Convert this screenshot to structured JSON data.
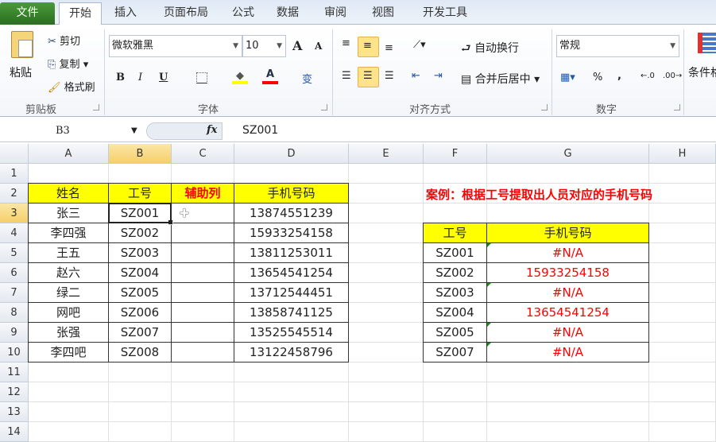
{
  "tabs": [
    "文件",
    "开始",
    "插入",
    "页面布局",
    "公式",
    "数据",
    "审阅",
    "视图",
    "开发工具"
  ],
  "ribbon": {
    "clipboard": {
      "paste": "粘贴",
      "cut": "剪切",
      "copy": "复制",
      "format_painter": "格式刷",
      "label": "剪贴板"
    },
    "font": {
      "name": "微软雅黑",
      "size": "10",
      "bold": "B",
      "italic": "I",
      "underline": "U",
      "label": "字体",
      "grow": "A",
      "shrink": "A",
      "phonetic": "变"
    },
    "align": {
      "wrap": "自动换行",
      "merge": "合并后居中",
      "label": "对齐方式"
    },
    "number": {
      "format": "常规",
      "percent": "%",
      "comma": ",",
      "label": "数字"
    },
    "styles": {
      "conditional": "条件格"
    }
  },
  "formula_bar": {
    "name_box": "B3",
    "fx": "fx",
    "value": "SZ001"
  },
  "columns": [
    "A",
    "B",
    "C",
    "D",
    "E",
    "F",
    "G",
    "H"
  ],
  "rows": [
    "1",
    "2",
    "3",
    "4",
    "5",
    "6",
    "7",
    "8",
    "9",
    "10",
    "11",
    "12",
    "13",
    "14"
  ],
  "table1": {
    "headers": [
      "姓名",
      "工号",
      "辅助列",
      "手机号码"
    ],
    "rows": [
      [
        "张三",
        "SZ001",
        "",
        "13874551239"
      ],
      [
        "李四强",
        "SZ002",
        "",
        "15933254158"
      ],
      [
        "王五",
        "SZ003",
        "",
        "13811253011"
      ],
      [
        "赵六",
        "SZ004",
        "",
        "13654541254"
      ],
      [
        "绿二",
        "SZ005",
        "",
        "13712544451"
      ],
      [
        "网吧",
        "SZ006",
        "",
        "13858741125"
      ],
      [
        "张强",
        "SZ007",
        "",
        "13525545514"
      ],
      [
        "李四吧",
        "SZ008",
        "",
        "13122458796"
      ]
    ]
  },
  "case_title": "案例：根据工号提取出人员对应的手机号码",
  "table2": {
    "headers": [
      "工号",
      "手机号码"
    ],
    "rows": [
      [
        "SZ001",
        "#N/A"
      ],
      [
        "SZ002",
        "15933254158"
      ],
      [
        "SZ003",
        "#N/A"
      ],
      [
        "SZ004",
        "13654541254"
      ],
      [
        "SZ005",
        "#N/A"
      ],
      [
        "SZ007",
        "#N/A"
      ]
    ]
  },
  "colors": {
    "header_fill": "#ffff00",
    "error_text": "#ff0000",
    "title_text": "#ff0000"
  }
}
